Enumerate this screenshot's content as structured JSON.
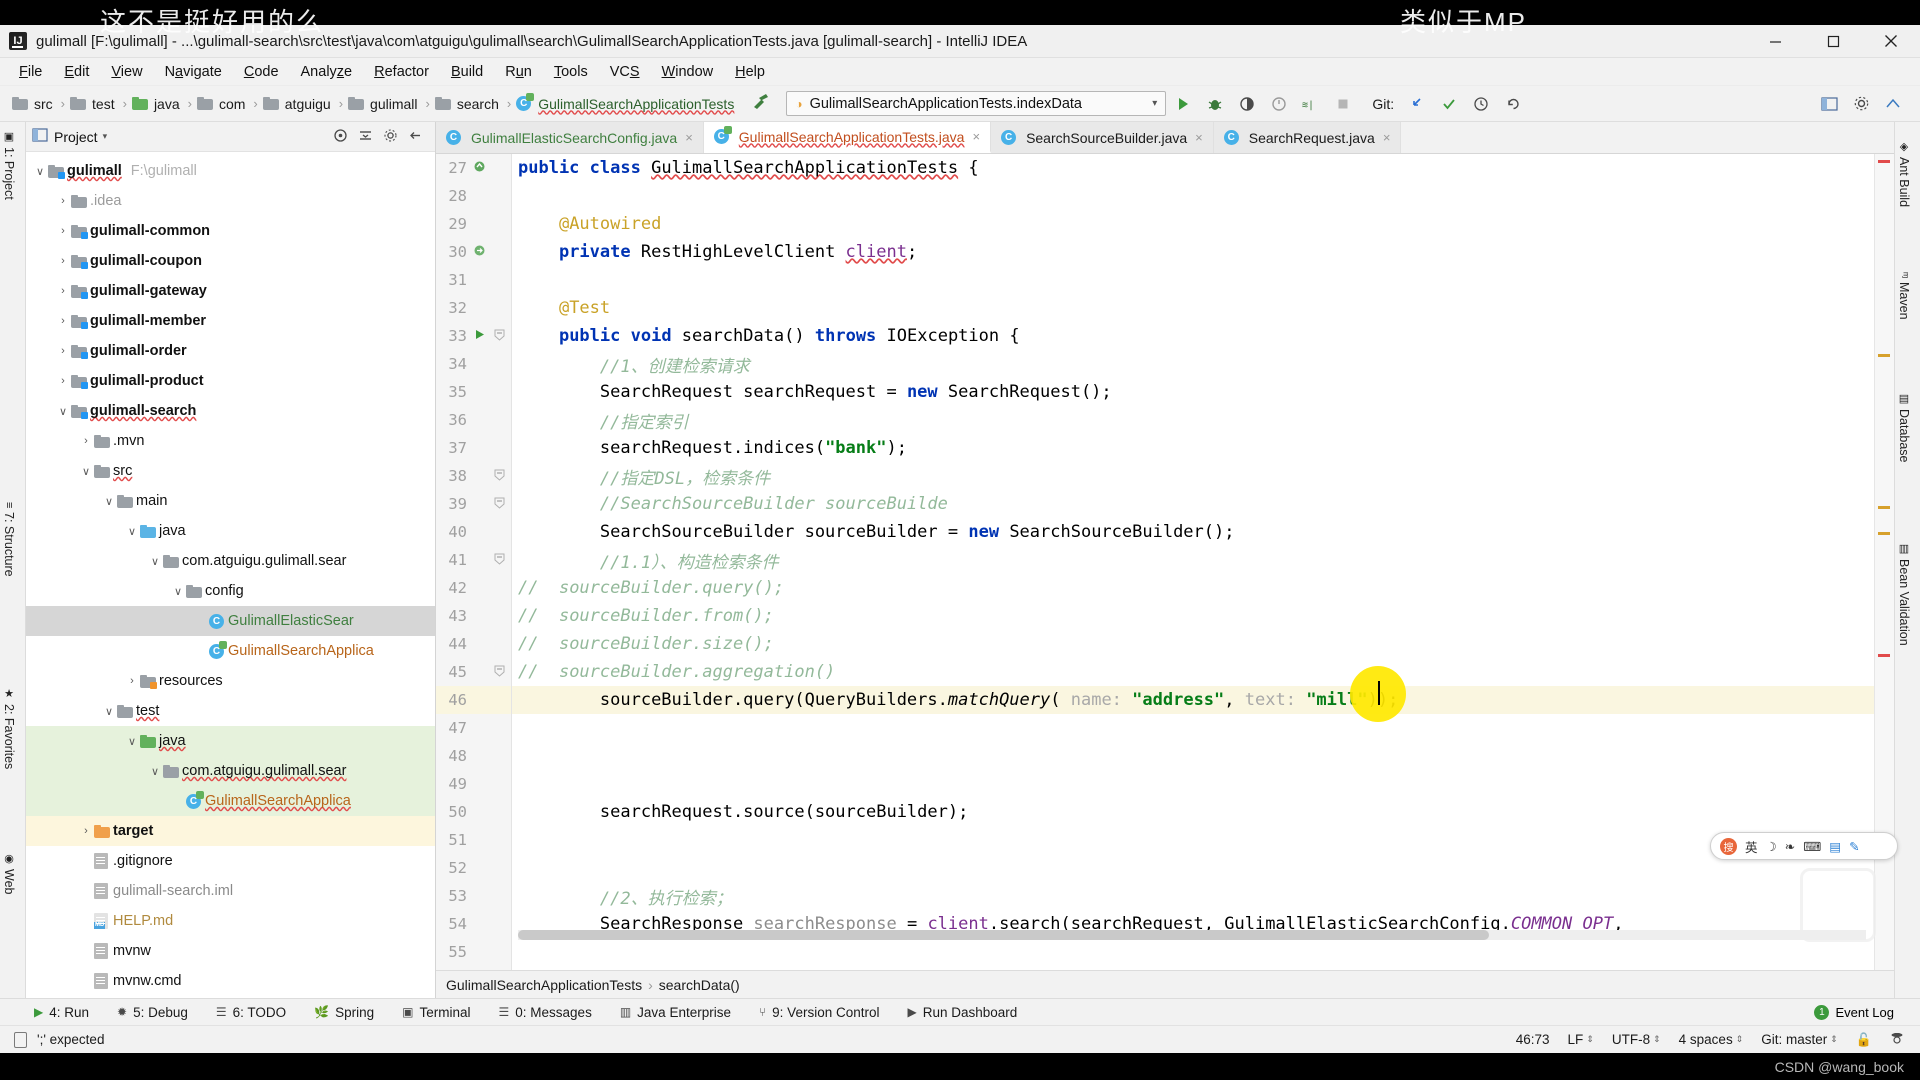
{
  "watermarks": {
    "left": "这不是挺好用的么",
    "right": "类似于MP",
    "csdn": "CSDN @wang_book"
  },
  "titlebar": {
    "app_icon": "intellij-logo-icon",
    "title": "gulimall [F:\\gulimall] - ...\\gulimall-search\\src\\test\\java\\com\\atguigu\\gulimall\\search\\GulimallSearchApplicationTests.java [gulimall-search] - IntelliJ IDEA",
    "minimize": "minimize-icon",
    "maximize": "maximize-icon",
    "close": "close-icon"
  },
  "menubar": {
    "items": [
      "File",
      "Edit",
      "View",
      "Navigate",
      "Code",
      "Analyze",
      "Refactor",
      "Build",
      "Run",
      "Tools",
      "VCS",
      "Window",
      "Help"
    ]
  },
  "navbar": {
    "breadcrumbs": [
      {
        "label": "src",
        "icon": "folder-icon"
      },
      {
        "label": "test",
        "icon": "folder-icon"
      },
      {
        "label": "java",
        "icon": "folder-green-icon"
      },
      {
        "label": "com",
        "icon": "folder-icon"
      },
      {
        "label": "atguigu",
        "icon": "folder-icon"
      },
      {
        "label": "gulimall",
        "icon": "folder-icon"
      },
      {
        "label": "search",
        "icon": "folder-icon"
      },
      {
        "label": "GulimallSearchApplicationTests",
        "icon": "class-test-icon"
      }
    ],
    "build_icon": "hammer-icon",
    "run_config": {
      "icon": "run-config-icon",
      "value": "GulimallSearchApplicationTests.indexData",
      "caret": "chevron-down-icon"
    },
    "buttons": [
      {
        "name": "run-button",
        "glyph": "▶"
      },
      {
        "name": "debug-button",
        "glyph": "✱"
      },
      {
        "name": "run-coverage-button",
        "glyph": "◑"
      },
      {
        "name": "profiler-button",
        "glyph": "◔"
      },
      {
        "name": "run-with-button",
        "glyph": "≡"
      },
      {
        "name": "stop-button",
        "glyph": "■"
      }
    ],
    "git_label": "Git:",
    "git_buttons": [
      {
        "name": "update-project-button",
        "glyph": "↙"
      },
      {
        "name": "commit-button",
        "glyph": "✓"
      },
      {
        "name": "history-button",
        "glyph": "◴"
      },
      {
        "name": "rollback-button",
        "glyph": "↶"
      }
    ],
    "right_buttons": [
      {
        "name": "search-everywhere-button",
        "glyph": "▦"
      },
      {
        "name": "settings-button",
        "glyph": "⚙"
      },
      {
        "name": "help-button",
        "glyph": "⍰"
      }
    ]
  },
  "left_strip": {
    "items": [
      "1: Project",
      "7: Structure",
      "2: Favorites",
      "Web"
    ]
  },
  "right_strip": {
    "items": [
      "Ant Build",
      "Maven",
      "Database",
      "Bean Validation"
    ]
  },
  "project_panel": {
    "title": "Project",
    "caret": "chevron-down-icon",
    "actions": [
      "target-icon",
      "collapse-all-icon",
      "settings-gear-icon",
      "hide-icon"
    ],
    "tree": [
      {
        "indent": 0,
        "arrow": "v",
        "icon": "module-folder-icon",
        "label": "gulimall",
        "style": "bold squiggle",
        "path": "F:\\gulimall"
      },
      {
        "indent": 1,
        "arrow": ">",
        "icon": "folder-icon",
        "label": ".idea",
        "style": "muted"
      },
      {
        "indent": 1,
        "arrow": ">",
        "icon": "module-folder-icon",
        "label": "gulimall-common",
        "style": "bold"
      },
      {
        "indent": 1,
        "arrow": ">",
        "icon": "module-folder-icon",
        "label": "gulimall-coupon",
        "style": "bold"
      },
      {
        "indent": 1,
        "arrow": ">",
        "icon": "module-folder-icon",
        "label": "gulimall-gateway",
        "style": "bold"
      },
      {
        "indent": 1,
        "arrow": ">",
        "icon": "module-folder-icon",
        "label": "gulimall-member",
        "style": "bold"
      },
      {
        "indent": 1,
        "arrow": ">",
        "icon": "module-folder-icon",
        "label": "gulimall-order",
        "style": "bold"
      },
      {
        "indent": 1,
        "arrow": ">",
        "icon": "module-folder-icon",
        "label": "gulimall-product",
        "style": "bold"
      },
      {
        "indent": 1,
        "arrow": "v",
        "icon": "module-folder-icon",
        "label": "gulimall-search",
        "style": "bold squiggle"
      },
      {
        "indent": 2,
        "arrow": ">",
        "icon": "folder-icon",
        "label": ".mvn",
        "style": "normal"
      },
      {
        "indent": 2,
        "arrow": "v",
        "icon": "folder-icon",
        "label": "src",
        "style": "squiggle"
      },
      {
        "indent": 3,
        "arrow": "v",
        "icon": "folder-icon",
        "label": "main",
        "style": "normal"
      },
      {
        "indent": 4,
        "arrow": "v",
        "icon": "folder-blue-icon",
        "label": "java",
        "style": "normal"
      },
      {
        "indent": 5,
        "arrow": "v",
        "icon": "package-icon",
        "label": "com.atguigu.gulimall.sear",
        "style": "normal"
      },
      {
        "indent": 6,
        "arrow": "v",
        "icon": "package-icon",
        "label": "config",
        "style": "normal"
      },
      {
        "indent": 7,
        "arrow": "",
        "icon": "class-icon",
        "label": "GulimallElasticSear",
        "style": "green",
        "row": "sel-grey"
      },
      {
        "indent": 7,
        "arrow": "",
        "icon": "class-spring-icon",
        "label": "GulimallSearchApplica",
        "style": "orange"
      },
      {
        "indent": 4,
        "arrow": ">",
        "icon": "resources-folder-icon",
        "label": "resources",
        "style": "normal"
      },
      {
        "indent": 3,
        "arrow": "v",
        "icon": "folder-icon",
        "label": "test",
        "style": "squiggle"
      },
      {
        "indent": 4,
        "arrow": "v",
        "icon": "folder-green-icon",
        "label": "java",
        "style": "squiggle",
        "row": "hl-green"
      },
      {
        "indent": 5,
        "arrow": "v",
        "icon": "package-icon",
        "label": "com.atguigu.gulimall.sear",
        "style": "squiggle",
        "row": "hl-green"
      },
      {
        "indent": 6,
        "arrow": "",
        "icon": "class-test-icon",
        "label": "GulimallSearchApplica",
        "style": "orange squiggle",
        "row": "hl-green"
      },
      {
        "indent": 2,
        "arrow": ">",
        "icon": "folder-orange-icon",
        "label": "target",
        "style": "bold",
        "row": "hl-yellow"
      },
      {
        "indent": 2,
        "arrow": "",
        "icon": "file-icon",
        "label": ".gitignore",
        "style": "normal"
      },
      {
        "indent": 2,
        "arrow": "",
        "icon": "file-iml-icon",
        "label": "gulimall-search.iml",
        "style": "grey"
      },
      {
        "indent": 2,
        "arrow": "",
        "icon": "file-md-icon",
        "label": "HELP.md",
        "style": "tan"
      },
      {
        "indent": 2,
        "arrow": "",
        "icon": "file-icon",
        "label": "mvnw",
        "style": "normal"
      },
      {
        "indent": 2,
        "arrow": "",
        "icon": "file-icon",
        "label": "mvnw.cmd",
        "style": "normal"
      }
    ]
  },
  "editor": {
    "tabs": [
      {
        "label": "GulimallElasticSearchConfig.java",
        "icon": "class-icon",
        "color": "green",
        "active": false
      },
      {
        "label": "GulimallSearchApplicationTests.java",
        "icon": "class-test-icon",
        "color": "orange",
        "active": true
      },
      {
        "label": "SearchSourceBuilder.java",
        "icon": "class-icon",
        "color": "black",
        "active": false
      },
      {
        "label": "SearchRequest.java",
        "icon": "class-icon",
        "color": "black",
        "active": false
      }
    ],
    "first_line_number": 27,
    "lines": [
      {
        "n": 27,
        "mark": "override-icon",
        "fold": "",
        "hl": false,
        "tokens": [
          {
            "t": "public ",
            "c": "kw"
          },
          {
            "t": "class ",
            "c": "kw"
          },
          {
            "t": "GulimallSearchApplicationTests",
            "c": "sq-red"
          },
          {
            "t": " {",
            "c": ""
          }
        ],
        "indent": 0
      },
      {
        "n": 28,
        "mark": "",
        "fold": "",
        "hl": false,
        "tokens": [],
        "indent": 0
      },
      {
        "n": 29,
        "mark": "",
        "fold": "",
        "hl": false,
        "tokens": [
          {
            "t": "@Autowired",
            "c": "anno"
          }
        ],
        "indent": 1
      },
      {
        "n": 30,
        "mark": "bean-icon",
        "fold": "",
        "hl": false,
        "tokens": [
          {
            "t": "private ",
            "c": "kw"
          },
          {
            "t": "RestHighLevelClient ",
            "c": ""
          },
          {
            "t": "client",
            "c": "fld sq-red"
          },
          {
            "t": ";",
            "c": ""
          }
        ],
        "indent": 1
      },
      {
        "n": 31,
        "mark": "",
        "fold": "",
        "hl": false,
        "tokens": [],
        "indent": 0
      },
      {
        "n": 32,
        "mark": "",
        "fold": "",
        "hl": false,
        "tokens": [
          {
            "t": "@Test",
            "c": "anno"
          }
        ],
        "indent": 1
      },
      {
        "n": 33,
        "mark": "run-test-icon",
        "fold": "-",
        "hl": false,
        "tokens": [
          {
            "t": "public ",
            "c": "kw"
          },
          {
            "t": "void ",
            "c": "kw"
          },
          {
            "t": "searchData",
            "c": ""
          },
          {
            "t": "() ",
            "c": ""
          },
          {
            "t": "throws ",
            "c": "kw"
          },
          {
            "t": "IOException {",
            "c": ""
          }
        ],
        "indent": 1
      },
      {
        "n": 34,
        "mark": "",
        "fold": "",
        "hl": false,
        "tokens": [
          {
            "t": "//1、创建检索请求",
            "c": "cmt-green"
          }
        ],
        "indent": 2
      },
      {
        "n": 35,
        "mark": "",
        "fold": "",
        "hl": false,
        "tokens": [
          {
            "t": "SearchRequest searchRequest = ",
            "c": ""
          },
          {
            "t": "new ",
            "c": "kw"
          },
          {
            "t": "SearchRequest();",
            "c": ""
          }
        ],
        "indent": 2
      },
      {
        "n": 36,
        "mark": "",
        "fold": "",
        "hl": false,
        "tokens": [
          {
            "t": "//指定索引",
            "c": "cmt-green"
          }
        ],
        "indent": 2
      },
      {
        "n": 37,
        "mark": "",
        "fold": "",
        "hl": false,
        "tokens": [
          {
            "t": "searchRequest.indices(",
            "c": ""
          },
          {
            "t": "\"bank\"",
            "c": "str"
          },
          {
            "t": ");",
            "c": ""
          }
        ],
        "indent": 2
      },
      {
        "n": 38,
        "mark": "",
        "fold": "-",
        "hl": false,
        "tokens": [
          {
            "t": "//指定DSL，检索条件",
            "c": "cmt-green"
          }
        ],
        "indent": 2
      },
      {
        "n": 39,
        "mark": "",
        "fold": "-",
        "hl": false,
        "tokens": [
          {
            "t": "//SearchSourceBuilder sourceBuilde",
            "c": "cmt-green ital"
          }
        ],
        "indent": 2
      },
      {
        "n": 40,
        "mark": "",
        "fold": "",
        "hl": false,
        "tokens": [
          {
            "t": "SearchSourceBuilder sourceBuilder = ",
            "c": ""
          },
          {
            "t": "new ",
            "c": "kw"
          },
          {
            "t": "SearchSourceBuilder();",
            "c": ""
          }
        ],
        "indent": 2
      },
      {
        "n": 41,
        "mark": "",
        "fold": "-",
        "hl": false,
        "tokens": [
          {
            "t": "//1.1）、构造检索条件",
            "c": "cmt-green"
          }
        ],
        "indent": 2
      },
      {
        "n": 42,
        "mark": "",
        "fold": "",
        "hl": false,
        "prefix": "//",
        "tokens": [
          {
            "t": "  sourceBuilder.query();",
            "c": "cmt-green ital"
          }
        ],
        "indent": 2
      },
      {
        "n": 43,
        "mark": "",
        "fold": "",
        "hl": false,
        "prefix": "//",
        "tokens": [
          {
            "t": "  sourceBuilder.from();",
            "c": "cmt-green ital"
          }
        ],
        "indent": 2
      },
      {
        "n": 44,
        "mark": "",
        "fold": "",
        "hl": false,
        "prefix": "//",
        "tokens": [
          {
            "t": "  sourceBuilder.size();",
            "c": "cmt-green ital"
          }
        ],
        "indent": 2
      },
      {
        "n": 45,
        "mark": "",
        "fold": "-",
        "hl": false,
        "prefix": "//",
        "tokens": [
          {
            "t": "  sourceBuilder.aggregation()",
            "c": "cmt-green ital"
          }
        ],
        "indent": 2
      },
      {
        "n": 46,
        "mark": "",
        "fold": "",
        "hl": true,
        "tokens": [
          {
            "t": "sourceBuilder.query(QueryBuilders.",
            "c": ""
          },
          {
            "t": "matchQuery",
            "c": "ital"
          },
          {
            "t": "( ",
            "c": ""
          },
          {
            "t": "name: ",
            "c": "param-hint"
          },
          {
            "t": "\"address\"",
            "c": "str"
          },
          {
            "t": ", ",
            "c": ""
          },
          {
            "t": "text: ",
            "c": "param-hint"
          },
          {
            "t": "\"mill\"",
            "c": "str"
          },
          {
            "t": "));",
            "c": ""
          }
        ],
        "indent": 2
      },
      {
        "n": 47,
        "mark": "",
        "fold": "",
        "hl": false,
        "tokens": [],
        "indent": 0
      },
      {
        "n": 48,
        "mark": "",
        "fold": "",
        "hl": false,
        "tokens": [],
        "indent": 0
      },
      {
        "n": 49,
        "mark": "",
        "fold": "",
        "hl": false,
        "tokens": [],
        "indent": 0
      },
      {
        "n": 50,
        "mark": "",
        "fold": "",
        "hl": false,
        "tokens": [
          {
            "t": "searchRequest.source(sourceBuilder);",
            "c": ""
          }
        ],
        "indent": 2
      },
      {
        "n": 51,
        "mark": "",
        "fold": "",
        "hl": false,
        "tokens": [],
        "indent": 0
      },
      {
        "n": 52,
        "mark": "",
        "fold": "",
        "hl": false,
        "tokens": [],
        "indent": 0
      },
      {
        "n": 53,
        "mark": "",
        "fold": "",
        "hl": false,
        "tokens": [
          {
            "t": "//2、执行检索；",
            "c": "cmt-green"
          }
        ],
        "indent": 2
      },
      {
        "n": 54,
        "mark": "",
        "fold": "",
        "hl": false,
        "tokens": [
          {
            "t": "SearchResponse ",
            "c": ""
          },
          {
            "t": "searchResponse",
            "c": "var-grey"
          },
          {
            "t": " = ",
            "c": ""
          },
          {
            "t": "client",
            "c": "fld"
          },
          {
            "t": ".search(searchRequest, GulimallElasticSearchConfig.",
            "c": ""
          },
          {
            "t": "COMMON_OPT",
            "c": "const-ital"
          },
          {
            "t": ",",
            "c": ""
          }
        ],
        "indent": 2
      },
      {
        "n": 55,
        "mark": "",
        "fold": "",
        "hl": false,
        "tokens": [],
        "indent": 0
      }
    ],
    "breadcrumb": [
      "GulimallSearchApplicationTests",
      "searchData()"
    ],
    "caret_overlay": {
      "name": "text-cursor-highlight"
    }
  },
  "ime_popup": {
    "logo": "sogou-ime-icon",
    "items": [
      "英",
      "☽",
      "❧",
      "⌨",
      "▤",
      "✎"
    ]
  },
  "tool_windows": {
    "items": [
      {
        "label": "4: Run",
        "icon": "run-icon"
      },
      {
        "label": "5: Debug",
        "icon": "debug-icon"
      },
      {
        "label": "6: TODO",
        "icon": "todo-icon"
      },
      {
        "label": "Spring",
        "icon": "spring-leaf-icon"
      },
      {
        "label": "Terminal",
        "icon": "terminal-icon"
      },
      {
        "label": "0: Messages",
        "icon": "messages-icon"
      },
      {
        "label": "Java Enterprise",
        "icon": "java-enterprise-icon"
      },
      {
        "label": "9: Version Control",
        "icon": "version-control-icon"
      },
      {
        "label": "Run Dashboard",
        "icon": "run-dashboard-icon"
      }
    ],
    "event_log": {
      "label": "Event Log",
      "count": "1"
    }
  },
  "statusbar": {
    "message": "';' expected",
    "message_icon": "document-icon",
    "position": "46:73",
    "line_separator": "LF",
    "encoding": "UTF-8",
    "indent": "4 spaces",
    "branch": "Git: master",
    "lock_icon": "unlocked-icon",
    "inspector_icon": "hector-icon"
  },
  "colors": {
    "keyword": "#0033b3",
    "string": "#067d17",
    "comment": "#93b99a",
    "annotation": "#c9a227",
    "highlight_line": "#faf6e0",
    "cursor_blob": "#ffe800",
    "selection_grey": "#d6d6d6",
    "test_green": "#e6f2dc",
    "target_yellow": "#fdf6dd"
  }
}
